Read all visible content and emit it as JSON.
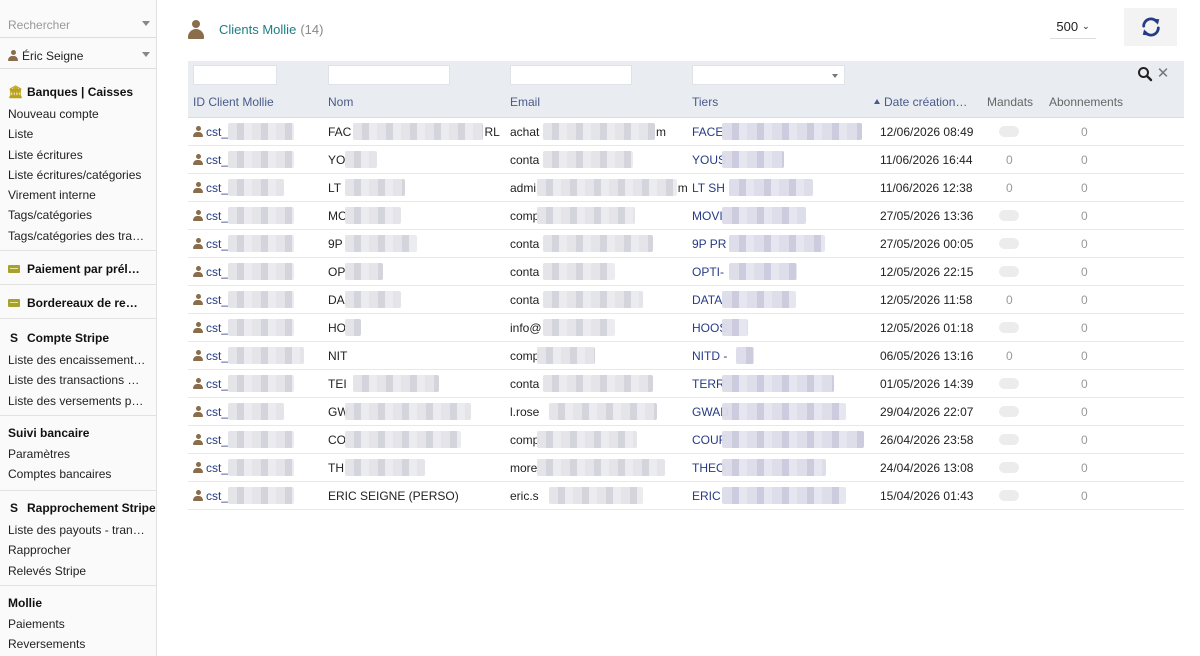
{
  "sidebar": {
    "search_placeholder": "Rechercher",
    "user": "Éric Seigne",
    "sections": {
      "banques": {
        "title": "Banques | Caisses",
        "icon": "bank-icon",
        "items": [
          "Nouveau compte",
          "Liste",
          "Liste écritures",
          "Liste écritures/catégories",
          "Virement interne",
          "Tags/catégories",
          "Tags/catégories des transactions"
        ]
      },
      "prelevement": {
        "title": "Paiement par prélèvement",
        "icon": "card-icon"
      },
      "bordereaux": {
        "title": "Bordereaux de remise",
        "icon": "card-icon"
      },
      "stripe": {
        "title": "Compte Stripe",
        "icon": "stripe-icon",
        "items": [
          "Liste des encaissements Stripe",
          "Liste des transactions Stripe",
          "Liste des versements par Stripe"
        ]
      },
      "suivi": {
        "title": "Suivi bancaire",
        "items": [
          "Paramètres",
          "Comptes bancaires"
        ]
      },
      "rapprochement": {
        "title": "Rapprochement Stripe",
        "icon": "stripe-icon",
        "items": [
          "Liste des payouts - transferts",
          "Rapprocher",
          "Relevés Stripe"
        ]
      },
      "mollie": {
        "title": "Mollie",
        "items": [
          "Paiements",
          "Reversements"
        ]
      }
    }
  },
  "header": {
    "title": "Clients Mollie",
    "count": "(14)",
    "per_page": "500",
    "refresh_icon": "refresh-icon"
  },
  "table": {
    "columns": {
      "id": "ID Client Mollie",
      "nom": "Nom",
      "email": "Email",
      "tiers": "Tiers",
      "date": "Date création Mollie",
      "mandats": "Mandats",
      "abonnements": "Abonnements"
    },
    "rows": [
      {
        "id": "cst_",
        "nom": "FAC",
        "nom_tail": "RL",
        "email": "achat",
        "email_tail": "m",
        "tiers": "FACE",
        "date": "12/06/2026 08:49",
        "mandats": "",
        "abonnements": "0"
      },
      {
        "id": "cst_",
        "nom": "YO",
        "nom_tail": "",
        "email": "conta",
        "email_tail": "",
        "tiers": "YOUS",
        "date": "11/06/2026 16:44",
        "mandats": "0",
        "abonnements": "0"
      },
      {
        "id": "cst_",
        "nom": "LT",
        "nom_tail": "",
        "email": "admi",
        "email_tail": "m",
        "tiers": "LT SH",
        "date": "11/06/2026 12:38",
        "mandats": "0",
        "abonnements": "0"
      },
      {
        "id": "cst_",
        "nom": "MC",
        "nom_tail": "",
        "email": "comp",
        "email_tail": "",
        "tiers": "MOVI",
        "date": "27/05/2026 13:36",
        "mandats": "",
        "abonnements": "0"
      },
      {
        "id": "cst_",
        "nom": "9P",
        "nom_tail": "",
        "email": "conta",
        "email_tail": "",
        "tiers": "9P PR",
        "date": "27/05/2026 00:05",
        "mandats": "",
        "abonnements": "0"
      },
      {
        "id": "cst_",
        "nom": "OP",
        "nom_tail": "",
        "email": "conta",
        "email_tail": "",
        "tiers": "OPTI-",
        "date": "12/05/2026 22:15",
        "mandats": "",
        "abonnements": "0"
      },
      {
        "id": "cst_",
        "nom": "DA",
        "nom_tail": "",
        "email": "conta",
        "email_tail": "",
        "tiers": "DATA",
        "date": "12/05/2026 11:58",
        "mandats": "0",
        "abonnements": "0"
      },
      {
        "id": "cst_",
        "nom": "HO",
        "nom_tail": "",
        "email": "info@",
        "email_tail": "",
        "tiers": "HOOS",
        "date": "12/05/2026 01:18",
        "mandats": "",
        "abonnements": "0"
      },
      {
        "id": "cst_",
        "nom": "NIT",
        "nom_tail": "",
        "email": "comp",
        "email_tail": "",
        "tiers": "NITD -",
        "date": "06/05/2026 13:16",
        "mandats": "0",
        "abonnements": "0"
      },
      {
        "id": "cst_",
        "nom": "TEI",
        "nom_tail": "",
        "email": "conta",
        "email_tail": "",
        "tiers": "TERR",
        "date": "01/05/2026 14:39",
        "mandats": "",
        "abonnements": "0"
      },
      {
        "id": "cst_",
        "nom": "GW",
        "nom_tail": "",
        "email": "l.rose",
        "email_tail": "",
        "tiers": "GWAD",
        "date": "29/04/2026 22:07",
        "mandats": "",
        "abonnements": "0"
      },
      {
        "id": "cst_",
        "nom": "CO",
        "nom_tail": "",
        "email": "comp",
        "email_tail": "",
        "tiers": "COUF",
        "date": "26/04/2026 23:58",
        "mandats": "",
        "abonnements": "0"
      },
      {
        "id": "cst_",
        "nom": "TH",
        "nom_tail": "",
        "email": "more",
        "email_tail": "",
        "tiers": "THEO",
        "date": "24/04/2026 13:08",
        "mandats": "",
        "abonnements": "0"
      },
      {
        "id": "cst_",
        "nom": "ERIC SEIGNE (PERSO)",
        "nom_tail": "",
        "email": "eric.s",
        "email_tail": "",
        "tiers": "ERIC",
        "date": "15/04/2026 01:43",
        "mandats": "",
        "abonnements": "0"
      }
    ]
  }
}
